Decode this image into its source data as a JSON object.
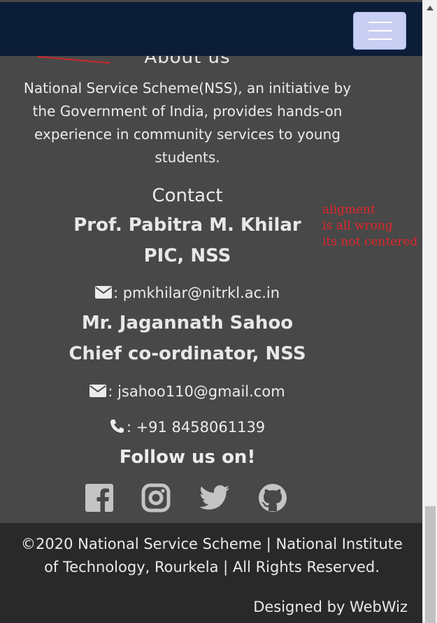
{
  "navbar": {
    "toggler_icon": "hamburger-icon"
  },
  "about": {
    "title": "About us",
    "text": "National Service Scheme(NSS), an initiative by the Government of India, provides hands-on experience in community services to young students."
  },
  "contact": {
    "title": "Contact",
    "person1": {
      "name": "Prof. Pabitra M. Khilar",
      "role": "PIC, NSS",
      "email_label": ": pmkhilar@nitrkl.ac.in",
      "email_icon": "envelope-icon"
    },
    "person2": {
      "name": "Mr. Jagannath Sahoo",
      "role": "Chief co-ordinator, NSS",
      "email_label": ": jsahoo110@gmail.com",
      "email_icon": "envelope-icon",
      "phone_label": ": +91 8458061139",
      "phone_icon": "phone-icon"
    }
  },
  "annotation": {
    "lines": [
      "aligment",
      "is all wrong",
      "its not centered"
    ]
  },
  "follow": {
    "title": "Follow us on!",
    "icons": [
      "facebook-icon",
      "instagram-icon",
      "twitter-icon",
      "github-icon"
    ]
  },
  "footer": {
    "copyright": "©2020 National Service Scheme | National Institute of Technology, Rourkela | All Rights Reserved.",
    "designed_by": "Designed by WebWiz"
  },
  "colors": {
    "navbar": "#0b1d37",
    "page_bg": "#484848",
    "footer_bg": "#292929",
    "annotation": "#e0262a",
    "toggler": "#c9cff2"
  }
}
